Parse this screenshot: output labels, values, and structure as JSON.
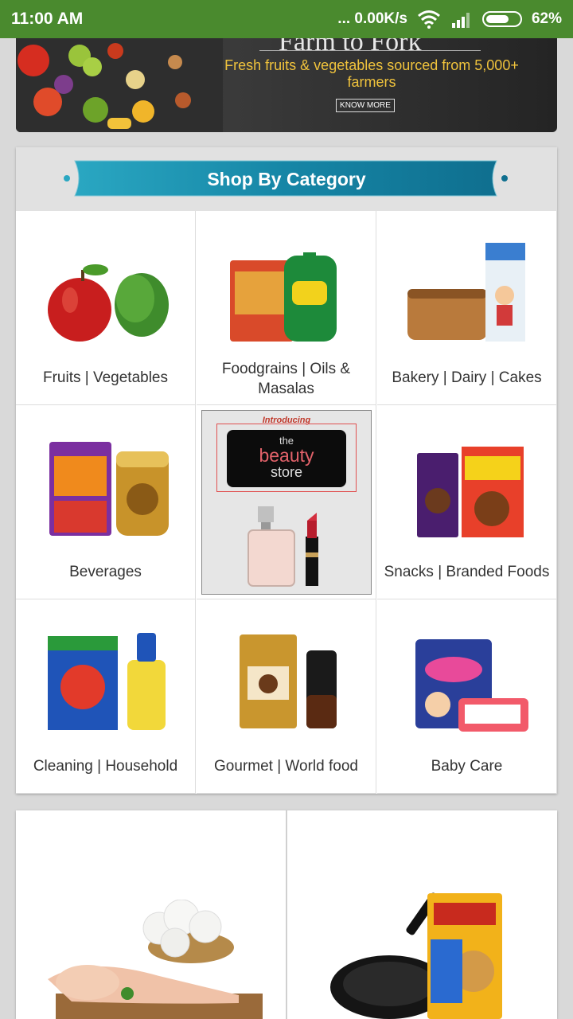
{
  "status_bar": {
    "time": "11:00 AM",
    "network_speed": "... 0.00K/s",
    "battery": "62%",
    "icons": [
      "wifi-icon",
      "signal-icon",
      "battery-icon"
    ]
  },
  "banner": {
    "title_partial": "Farm to Fork",
    "subtitle": "Fresh fruits & vegetables sourced from 5,000+ farmers",
    "cta": "KNOW MORE"
  },
  "category_section": {
    "title": "Shop By Category",
    "categories": [
      {
        "label": "Fruits | Vegetables"
      },
      {
        "label": "Foodgrains | Oils & Masalas"
      },
      {
        "label": "Bakery | Dairy | Cakes"
      },
      {
        "label": "Beverages"
      },
      {
        "label": ""
      },
      {
        "label": "Snacks | Branded Foods"
      },
      {
        "label": "Cleaning | Household"
      },
      {
        "label": "Gourmet | World food"
      },
      {
        "label": "Baby Care"
      }
    ],
    "beauty_store": {
      "intro": "Introducing",
      "the": "the",
      "beauty": "beauty",
      "store": "store"
    }
  },
  "promo": {
    "left_tile": "eggs-chicken-promo",
    "right_tile": "pet-kitchen-promo"
  },
  "colors": {
    "status_bar": "#4a8a2e",
    "ribbon": "#1b8fb0",
    "banner_text": "#f0c33c"
  }
}
